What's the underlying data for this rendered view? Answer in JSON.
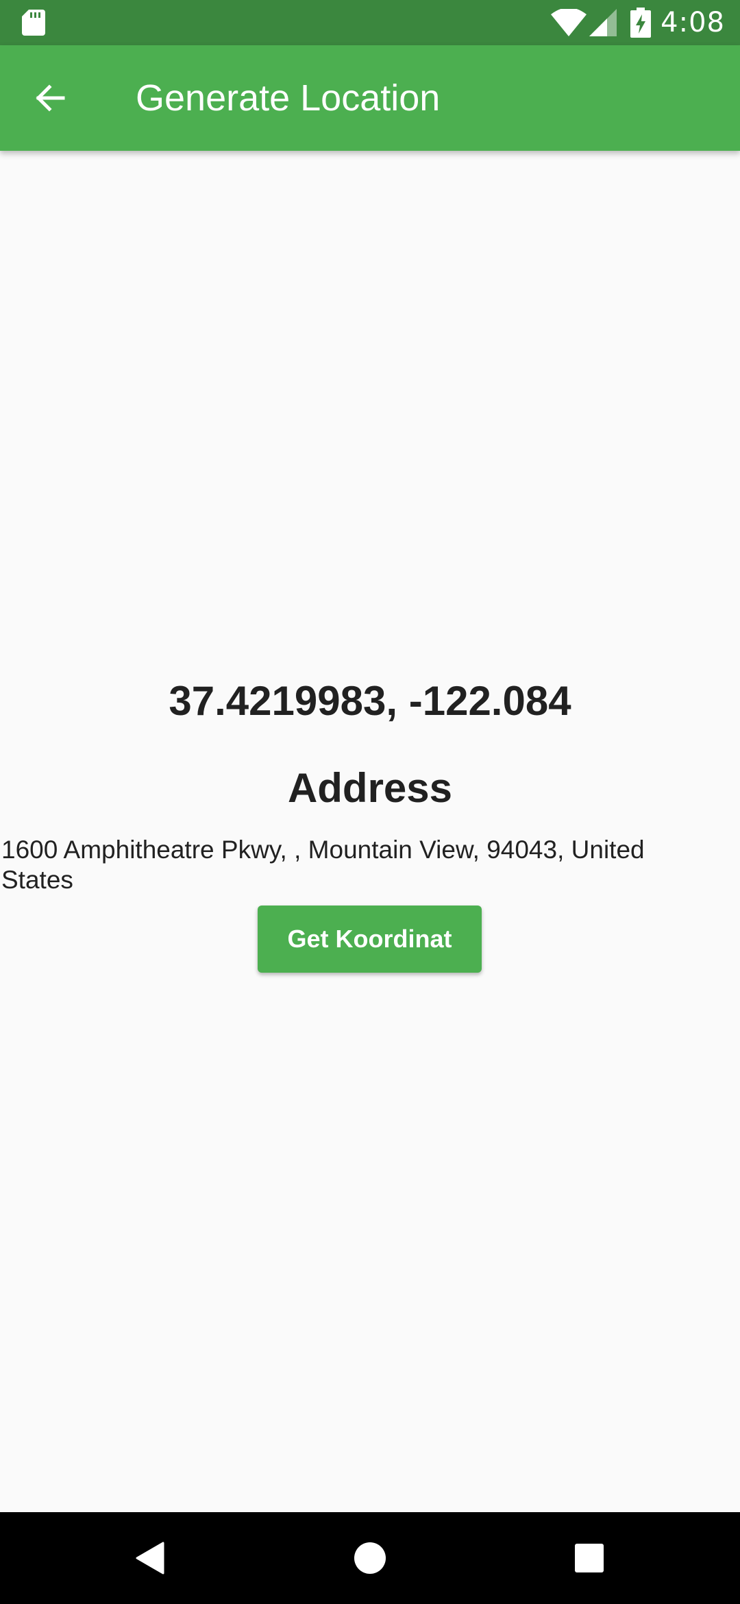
{
  "status_bar": {
    "time": "4:08",
    "icons": [
      "sd-card-icon",
      "wifi-icon",
      "signal-icon",
      "battery-charging-icon"
    ]
  },
  "app_bar": {
    "title": "Generate Location",
    "back_icon": "arrow-back-icon"
  },
  "location": {
    "coordinates": "37.4219983, -122.084",
    "address_heading": "Address",
    "address": "1600 Amphitheatre Pkwy, , Mountain View, 94043, United States"
  },
  "actions": {
    "get_coordinates_label": "Get Koordinat"
  },
  "nav_bar": {
    "icons": [
      "nav-back-icon",
      "nav-home-icon",
      "nav-recents-icon"
    ]
  },
  "colors": {
    "primary": "#4caf50",
    "primary_dark": "#3b873e",
    "background": "#fafafa",
    "text": "#212121"
  }
}
